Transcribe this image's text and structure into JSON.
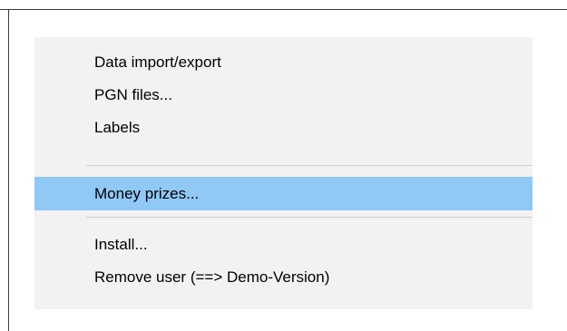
{
  "menu": {
    "items": [
      {
        "label": "Data import/export",
        "highlighted": false
      },
      {
        "label": "PGN files...",
        "highlighted": false
      },
      {
        "label": "Labels",
        "highlighted": false
      },
      {
        "label": "Money prizes...",
        "highlighted": true
      },
      {
        "label": "Install...",
        "highlighted": false
      },
      {
        "label": "Remove user (==> Demo-Version)",
        "highlighted": false
      }
    ],
    "colors": {
      "background": "#f2f2f2",
      "highlight": "#90c8f6",
      "separator": "#cfcfcf",
      "text": "#000000"
    }
  }
}
